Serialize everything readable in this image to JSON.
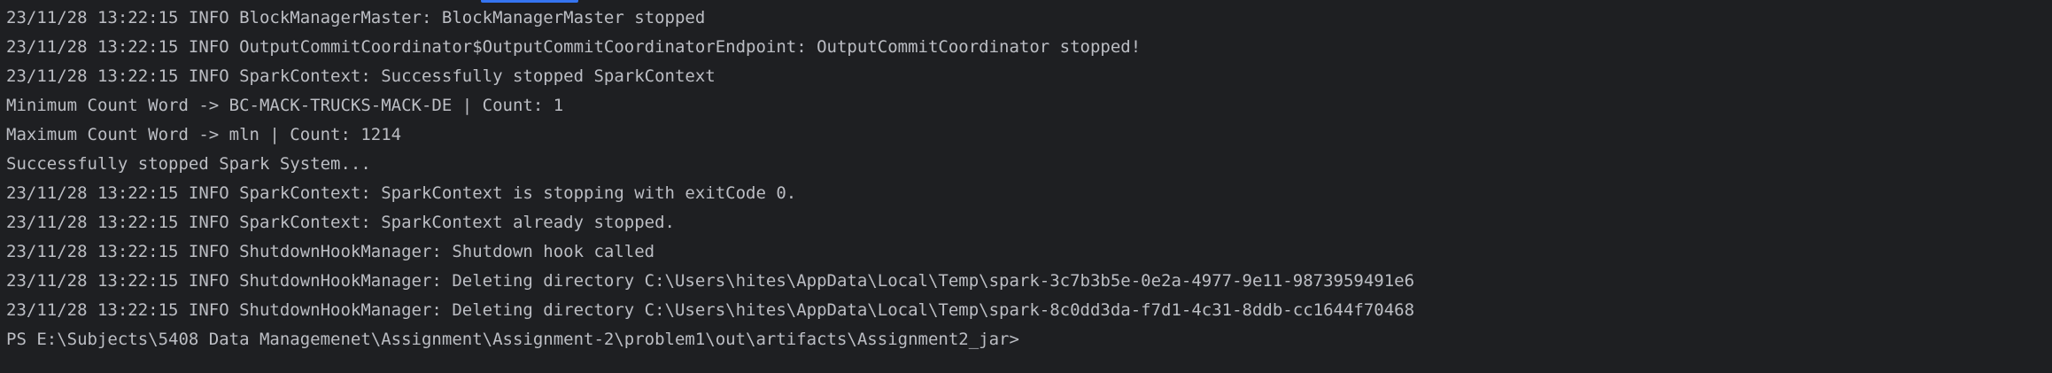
{
  "terminal": {
    "lines": [
      "23/11/28 13:22:15 INFO BlockManagerMaster: BlockManagerMaster stopped",
      "23/11/28 13:22:15 INFO OutputCommitCoordinator$OutputCommitCoordinatorEndpoint: OutputCommitCoordinator stopped!",
      "23/11/28 13:22:15 INFO SparkContext: Successfully stopped SparkContext",
      "Minimum Count Word -> BC-MACK-TRUCKS-MACK-DE | Count: 1",
      "Maximum Count Word -> mln | Count: 1214",
      "Successfully stopped Spark System...",
      "23/11/28 13:22:15 INFO SparkContext: SparkContext is stopping with exitCode 0.",
      "23/11/28 13:22:15 INFO SparkContext: SparkContext already stopped.",
      "23/11/28 13:22:15 INFO ShutdownHookManager: Shutdown hook called",
      "23/11/28 13:22:15 INFO ShutdownHookManager: Deleting directory C:\\Users\\hites\\AppData\\Local\\Temp\\spark-3c7b3b5e-0e2a-4977-9e11-9873959491e6",
      "23/11/28 13:22:15 INFO ShutdownHookManager: Deleting directory C:\\Users\\hites\\AppData\\Local\\Temp\\spark-8c0dd3da-f7d1-4c31-8ddb-cc1644f70468"
    ],
    "prompt": "PS E:\\Subjects\\5408 Data Managemenet\\Assignment\\Assignment-2\\problem1\\out\\artifacts\\Assignment2_jar>"
  },
  "colors": {
    "background": "#1e1f22",
    "text": "#bcbec4",
    "scroll_accent": "#3574f0"
  }
}
